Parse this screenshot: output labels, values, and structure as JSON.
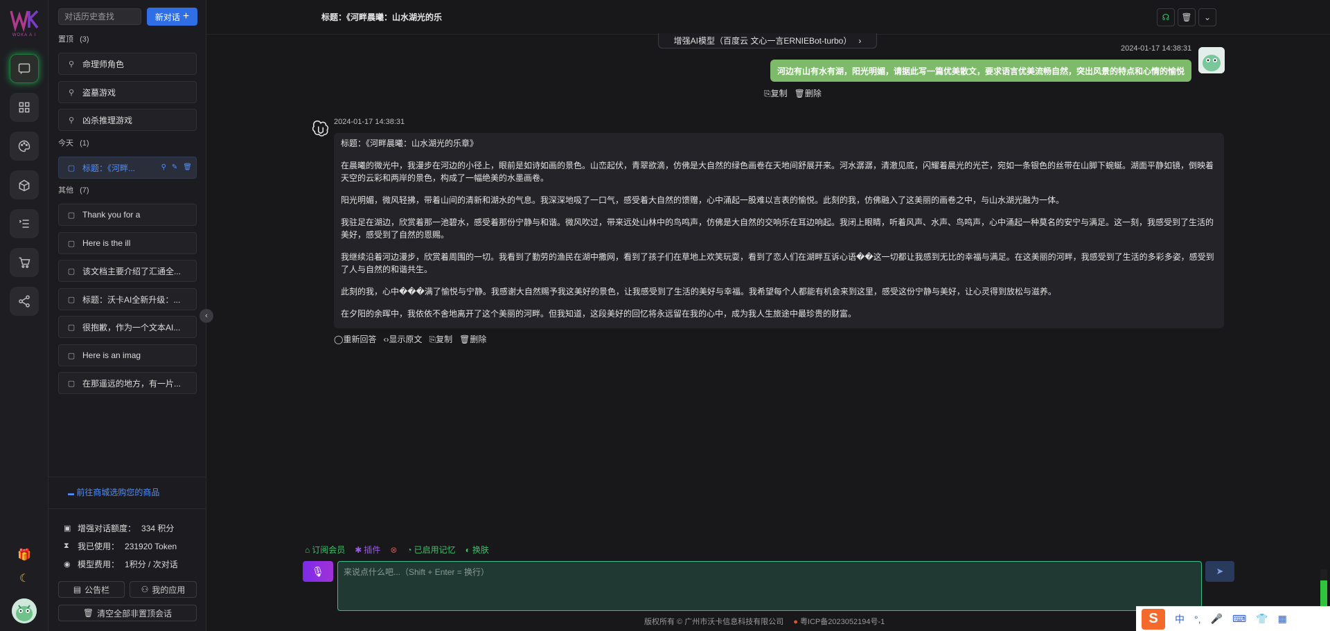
{
  "brand": {
    "logo": "WK",
    "tagline": "WOKA A I"
  },
  "rail": {
    "icons": [
      "chat-icon",
      "grid-icon",
      "palette-icon",
      "box-icon",
      "list-icon",
      "cart-icon",
      "share-icon"
    ],
    "bottom": [
      "gift-icon",
      "moon-icon",
      "avatar"
    ]
  },
  "sidebar": {
    "search_placeholder": "对话历史查找",
    "new_chat": "新对话",
    "pinned_label": "置顶",
    "pinned_count": "(3)",
    "pinned": [
      "命理师角色",
      "盗墓游戏",
      "凶杀推理游戏"
    ],
    "today_label": "今天",
    "today_count": "(1)",
    "today": [
      "标题：《河畔..."
    ],
    "other_label": "其他",
    "other_count": "(7)",
    "other": [
      "Thank you for a",
      "Here is the ill",
      "该文档主要介绍了汇通全...",
      "标题：沃卡AI全新升级：...",
      "很抱歉，作为一个文本AI...",
      "Here is an imag",
      "在那遥远的地方，有一片..."
    ],
    "shop_link": "前往商城选购您的商品",
    "quota_label": "增强对话额度：",
    "quota_value": "334 积分",
    "used_label": "我已使用：",
    "used_value": "231920 Token",
    "cost_label": "模型费用：",
    "cost_value": "1积分 / 次对话",
    "notice_btn": "公告栏",
    "apps_btn": "我的应用",
    "clear_btn": "清空全部非置顶会话"
  },
  "header": {
    "title": "标题：《河畔晨曦：山水湖光的乐",
    "model": "增强AI模型（百度云 文心一言ERNIEBot-turbo）"
  },
  "chat": {
    "user_time": "2024-01-17 14:38:31",
    "user_message": "河边有山有水有湖，阳光明媚，请据此写一篇优美散文，要求语言优美流畅自然，突出风景的特点和心情的愉悦",
    "user_actions": [
      "复制",
      "删除"
    ],
    "bot_time": "2024-01-17 14:38:31",
    "bot_paragraphs": [
      "标题：《河畔晨曦：山水湖光的乐章》",
      "在晨曦的微光中，我漫步在河边的小径上，眼前是如诗如画的景色。山峦起伏，青翠欲滴，仿佛是大自然的绿色画卷在天地间舒展开来。河水潺潺，清澈见底，闪耀着晨光的光芒，宛如一条银色的丝带在山脚下蜿蜒。湖面平静如镜，倒映着天空的云彩和两岸的景色，构成了一幅绝美的水墨画卷。",
      "阳光明媚，微风轻拂，带着山间的清新和湖水的气息。我深深地吸了一口气，感受着大自然的馈赠，心中涌起一股难以言表的愉悦。此刻的我，仿佛融入了这美丽的画卷之中，与山水湖光融为一体。",
      "我驻足在湖边，欣赏着那一池碧水，感受着那份宁静与和谐。微风吹过，带来远处山林中的鸟鸣声，仿佛是大自然的交响乐在耳边响起。我闭上眼睛，听着风声、水声、鸟鸣声，心中涌起一种莫名的安宁与满足。这一刻，我感受到了生活的美好，感受到了自然的恩赐。",
      "我继续沿着河边漫步，欣赏着周围的一切。我看到了勤劳的渔民在湖中撒网，看到了孩子们在草地上欢笑玩耍，看到了恋人们在湖畔互诉心语��这一切都让我感到无比的幸福与满足。在这美丽的河畔，我感受到了生活的多彩多姿，感受到了人与自然的和谐共生。",
      "此刻的我，心中���满了愉悦与宁静。我感谢大自然赐予我这美好的景色，让我感受到了生活的美好与幸福。我希望每个人都能有机会来到这里，感受这份宁静与美好，让心灵得到放松与滋养。",
      "在夕阳的余晖中，我依依不舍地离开了这个美丽的河畔。但我知道，这段美好的回忆将永远留在我的心中，成为我人生旅途中最珍贵的财富。"
    ],
    "bot_actions": [
      "重新回答",
      "显示原文",
      "复制",
      "删除"
    ]
  },
  "composer": {
    "tools": [
      "订阅会员",
      "插件",
      "",
      "已启用记忆",
      "换肤"
    ],
    "placeholder": "来说点什么吧...（Shift + Enter = 换行）"
  },
  "footer": {
    "copyright": "版权所有 © 广州市沃卡信息科技有限公司",
    "icp": "粤ICP备2023052194号-1"
  },
  "ime": {
    "logo": "S",
    "lang": "中",
    "punct": "°,"
  },
  "colors": {
    "accent": "#2f6ee5",
    "user_bubble": "#7dbb6a",
    "input_border": "#3bbf8a",
    "mic": "#8a2ee0"
  }
}
